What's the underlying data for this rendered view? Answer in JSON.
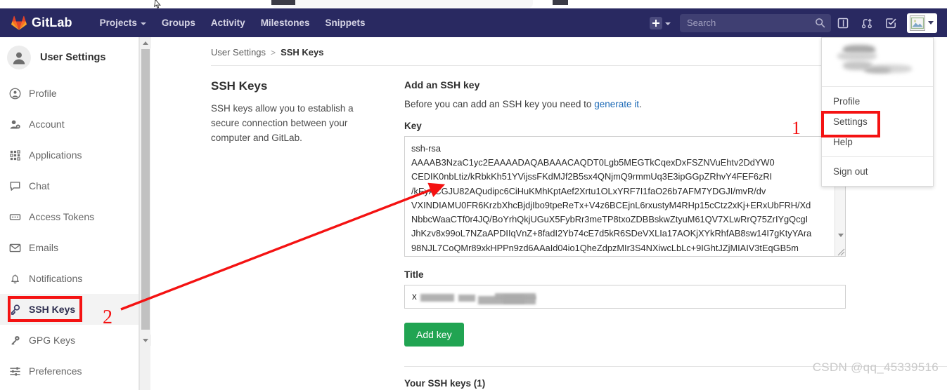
{
  "brand": {
    "name": "GitLab",
    "nav_bg": "#292961",
    "accent_green": "#21a452",
    "link_blue": "#1b69b6",
    "annotation_red": "#f41212"
  },
  "topnav": {
    "logo_label": "GitLab",
    "items": [
      {
        "label": "Projects",
        "has_caret": true
      },
      {
        "label": "Groups",
        "has_caret": false
      },
      {
        "label": "Activity",
        "has_caret": false
      },
      {
        "label": "Milestones",
        "has_caret": false
      },
      {
        "label": "Snippets",
        "has_caret": false
      }
    ],
    "new_button_icon": "plus-square-icon",
    "search": {
      "placeholder": "Search",
      "value": ""
    },
    "icons": [
      "issues-icon",
      "merge-requests-icon",
      "todos-icon"
    ],
    "avatar_icon": "user-avatar-image"
  },
  "user_dropdown": {
    "items_primary": [
      "Profile",
      "Settings",
      "Help"
    ],
    "items_secondary": [
      "Sign out"
    ],
    "header_redacted": true
  },
  "sidebar": {
    "user_title": "User Settings",
    "items": [
      {
        "label": "Profile",
        "icon": "user-circle-icon",
        "active": false
      },
      {
        "label": "Account",
        "icon": "user-gear-icon",
        "active": false
      },
      {
        "label": "Applications",
        "icon": "grid-dots-icon",
        "active": false
      },
      {
        "label": "Chat",
        "icon": "chat-bubble-icon",
        "active": false
      },
      {
        "label": "Access Tokens",
        "icon": "token-card-icon",
        "active": false
      },
      {
        "label": "Emails",
        "icon": "envelope-icon",
        "active": false
      },
      {
        "label": "Notifications",
        "icon": "bell-icon",
        "active": false
      },
      {
        "label": "SSH Keys",
        "icon": "key-icon",
        "active": true
      },
      {
        "label": "GPG Keys",
        "icon": "key-solid-icon",
        "active": false
      },
      {
        "label": "Preferences",
        "icon": "sliders-icon",
        "active": false
      }
    ]
  },
  "breadcrumb": {
    "parent": "User Settings",
    "separator": ">",
    "current": "SSH Keys"
  },
  "page": {
    "section_title": "SSH Keys",
    "section_description": "SSH keys allow you to establish a secure connection between your computer and GitLab.",
    "form_title": "Add an SSH key",
    "form_description_prefix": "Before you can add an SSH key you need to ",
    "form_description_link": "generate it",
    "form_description_suffix": ".",
    "key_label": "Key",
    "key_value_lines": [
      "ssh-rsa",
      "AAAAB3NzaC1yc2EAAAADAQABAAACAQDT0Lgb5MEGTkCqexDxFSZNVuEhtv2DdYW0",
      "CEDIK0nbLtiz/kRbkKh51YVijssFKdMJf2B5sx4QNjmQ9rmmUq3E3ipGGpZRhvY4FEF6zRI",
      "/kEyACGJU82AQudipc6CiHuKMhKptAef2Xrtu1OLxYRF7I1faO26b7AFM7YDGJI/mvR/dv",
      "VXINDIAMU0FR6KrzbXhcBjdjIbo9tpeReTx+V4z6BCEjnL6rxustyM4RHp15cCtz2xKj+ERxUbFRH/Xd",
      "NbbcWaaCTf0r4JQ/BoYrhQkjUGuX5FybRr3meTP8txoZDBBskwZtyuM61QV7XLwRrQ75ZrIYgQcgI",
      "JhKzv8x99oL7NZaAPDIIqVnZ+8fadI2Yb74cE7d5kR6SDeVXLIa17AOKjXYkRhfAB8sw14I7gKtyYAra",
      "98NJL7CoQMr89xkHPPn9zd6AAaId04io1QheZdpzMIr3S4NXiwcLbLc+9IGhtJZjMIAIV3tEqGB5m"
    ],
    "title_label": "Title",
    "title_value": "x",
    "title_value_redacted": true,
    "add_key_button": "Add key",
    "your_keys_heading": "Your SSH keys (1)"
  },
  "annotations": {
    "marker_one": "1",
    "marker_two": "2",
    "highlight_settings": "Settings",
    "highlight_ssh_keys": "SSH Keys"
  },
  "watermark": "CSDN @qq_45339516"
}
